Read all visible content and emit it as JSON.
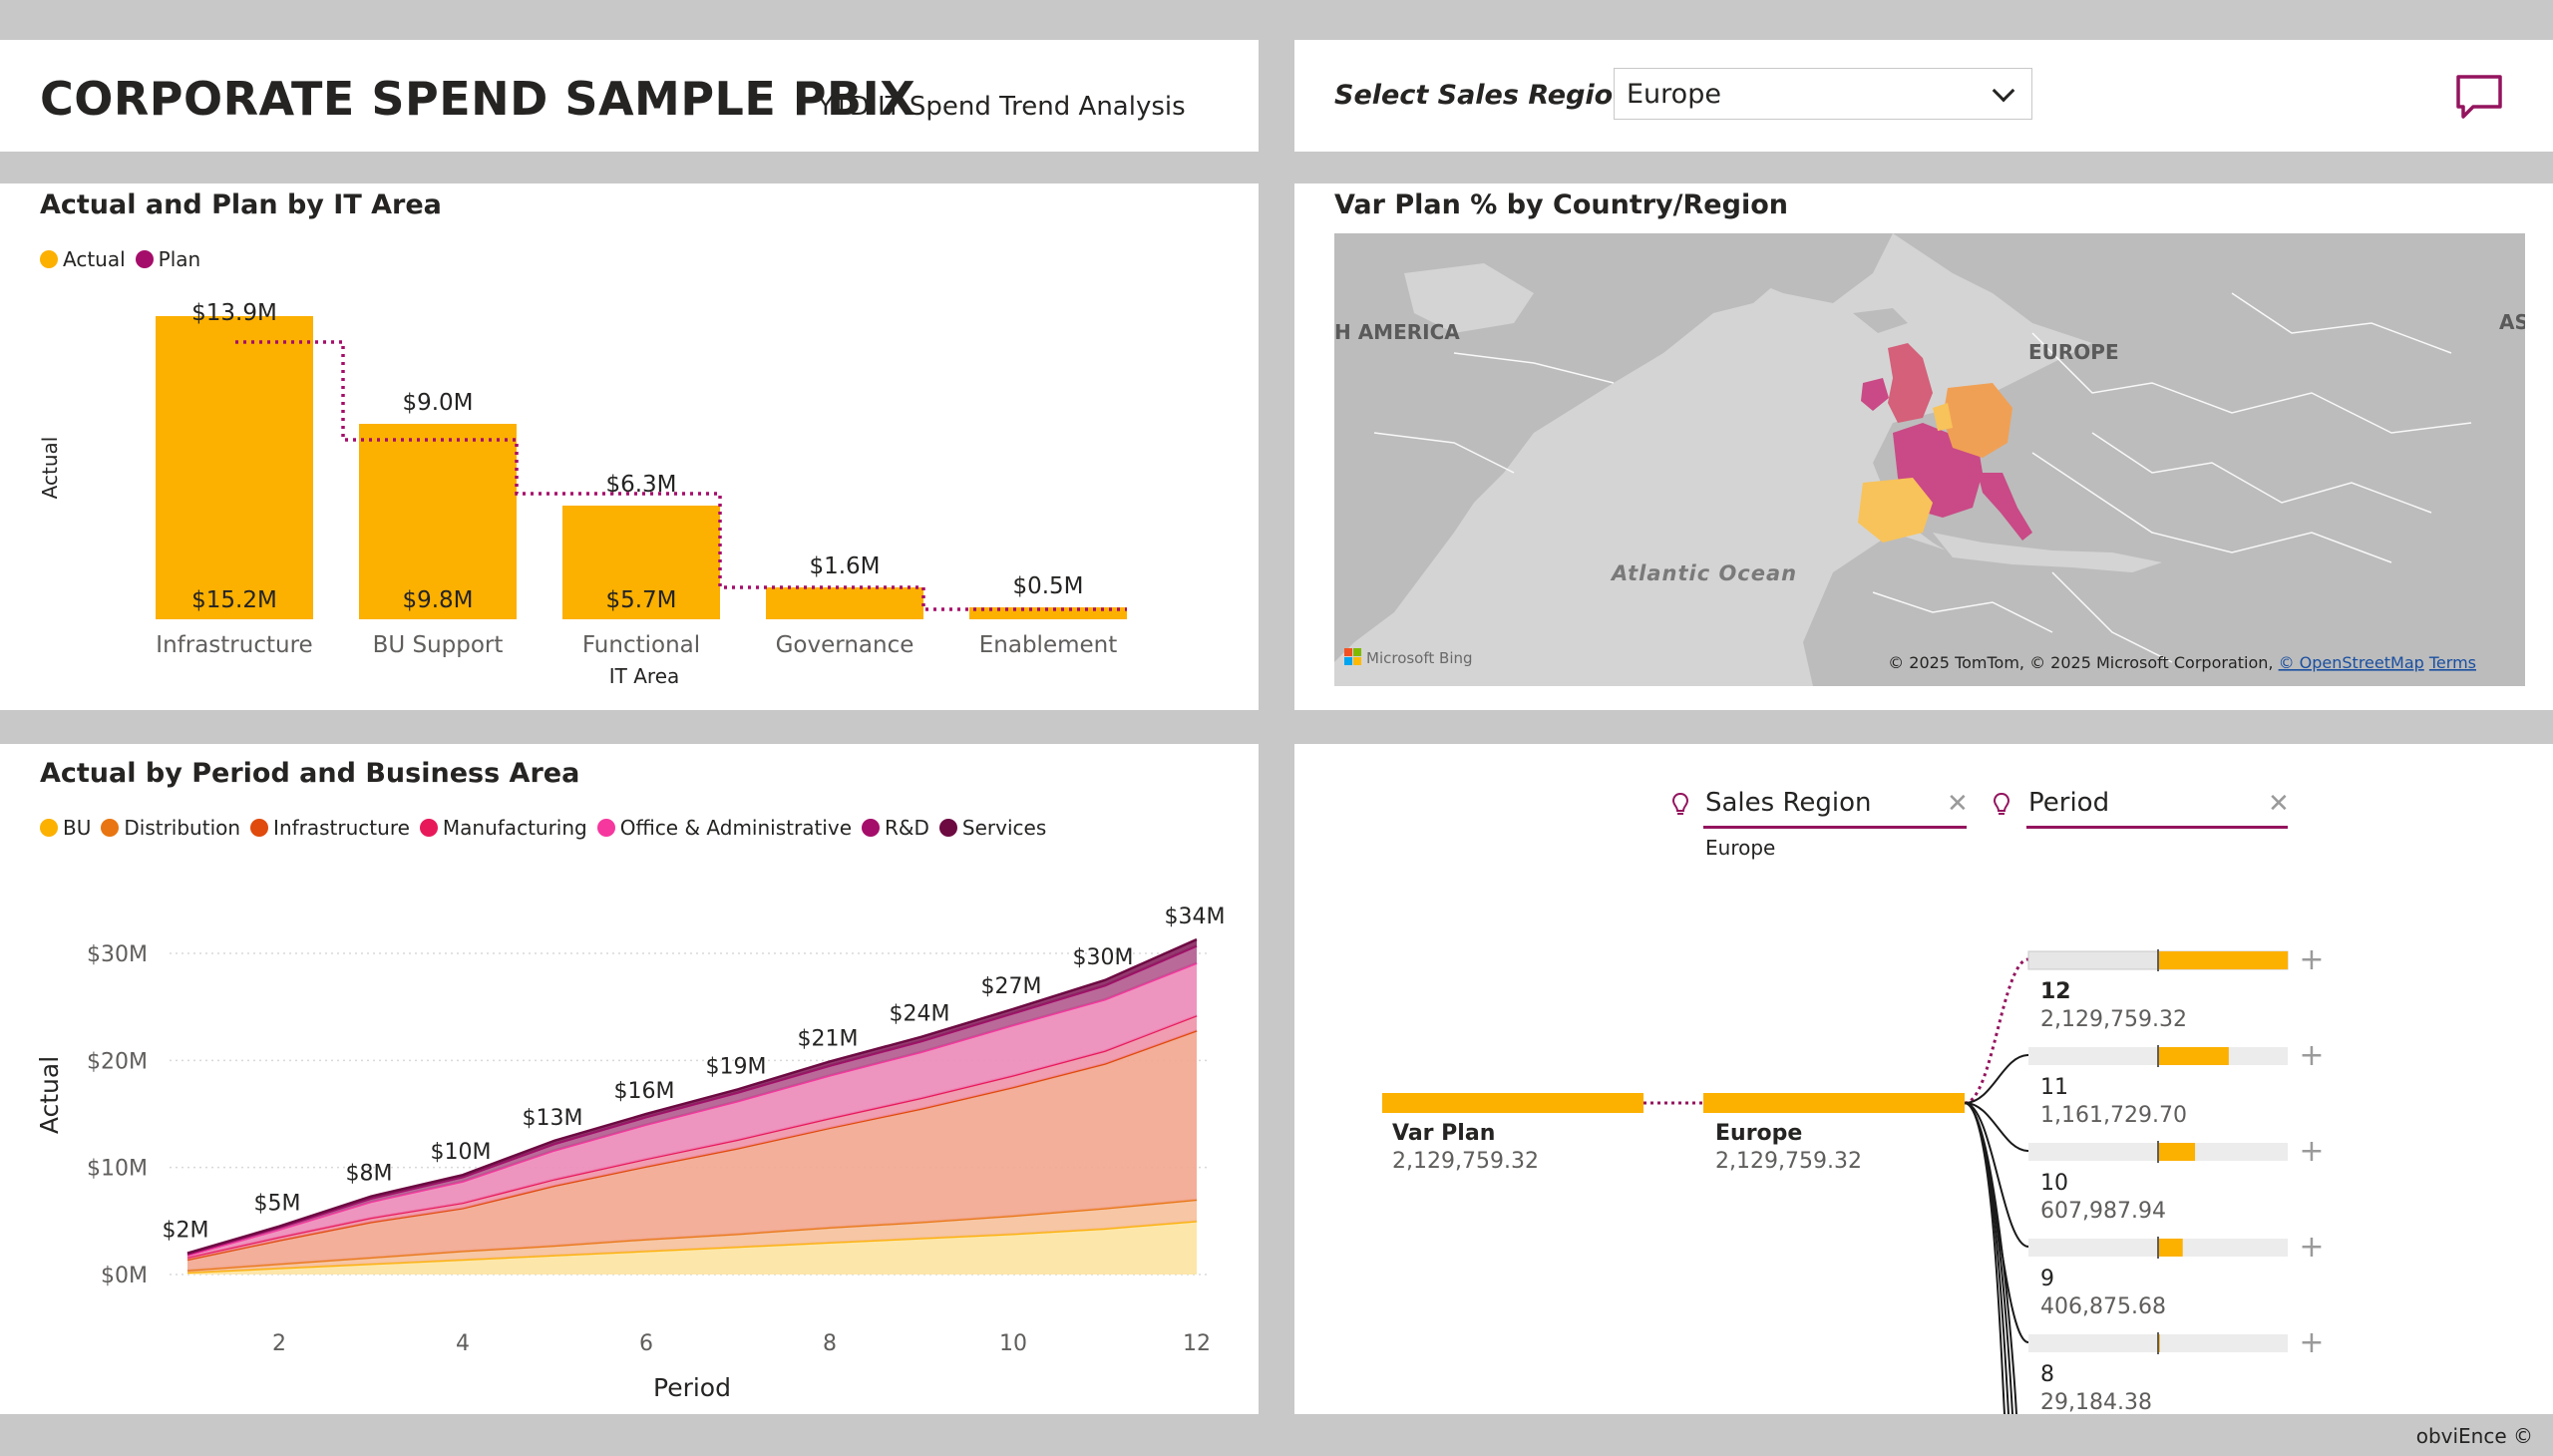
{
  "header": {
    "title": "CORPORATE SPEND SAMPLE PBIX",
    "subtitle": "YTD IT Spend Trend Analysis"
  },
  "filter": {
    "label": "Select Sales Region",
    "selected": "Europe"
  },
  "colors": {
    "actual": "#fcb000",
    "plan": "#a50d6a",
    "accent": "#94145e",
    "map_land": "#b9b9b9",
    "map_water": "#d4d4d4"
  },
  "icons": [
    "comment-icon",
    "chevron-down-icon",
    "lightbulb-icon",
    "close-icon",
    "plus-icon"
  ],
  "bar_chart": {
    "title": "Actual and Plan by IT Area",
    "legend": [
      "Actual",
      "Plan"
    ],
    "ylabel": "Actual",
    "xlabel": "IT Area",
    "xlabel_line1": "Functional",
    "xlabel_line2": "IT Area"
  },
  "map": {
    "title": "Var Plan % by Country/Region",
    "labels": {
      "north_america": "H AMERICA",
      "europe": "EUROPE",
      "asia": "AS",
      "ocean": "Atlantic Ocean"
    },
    "bing": "Microsoft Bing",
    "attribution": "© 2025 TomTom, © 2025 Microsoft Corporation, ",
    "osm": "© OpenStreetMap",
    "terms": "Terms"
  },
  "area_chart": {
    "title": "Actual by Period and Business Area",
    "ylabel": "Actual",
    "xlabel": "Period"
  },
  "decomp": {
    "fields": [
      {
        "label": "Sales Region",
        "value": "Europe"
      },
      {
        "label": "Period",
        "value": ""
      }
    ],
    "root": {
      "label": "Var Plan",
      "value": "2,129,759.32"
    },
    "level1": {
      "label": "Europe",
      "value": "2,129,759.32"
    },
    "nodes": [
      {
        "label": "12",
        "value": "2,129,759.32",
        "fraction": 1.0,
        "selected": true
      },
      {
        "label": "11",
        "value": "1,161,729.70",
        "fraction": 0.545
      },
      {
        "label": "10",
        "value": "607,987.94",
        "fraction": 0.285
      },
      {
        "label": "9",
        "value": "406,875.68",
        "fraction": 0.19
      },
      {
        "label": "8",
        "value": "29,184.38",
        "fraction": 0.014
      }
    ]
  },
  "footer": "obviEnce ©",
  "chart_data": [
    {
      "type": "bar",
      "title": "Actual and Plan by IT Area",
      "xlabel": "IT Area",
      "ylabel": "Actual",
      "categories": [
        "Infrastructure",
        "BU Support",
        "Functional",
        "Governance",
        "Enablement"
      ],
      "series": [
        {
          "name": "Actual",
          "values": [
            15.2,
            9.8,
            5.7,
            1.6,
            0.5
          ],
          "labels": [
            "$15.2M",
            "$9.8M",
            "$5.7M",
            "",
            ""
          ]
        },
        {
          "name": "Plan",
          "values": [
            13.9,
            9.0,
            6.3,
            1.6,
            0.5
          ],
          "labels": [
            "$13.9M",
            "$9.0M",
            "$6.3M",
            "$1.6M",
            "$0.5M"
          ]
        }
      ],
      "legend": "top-left"
    },
    {
      "type": "area",
      "title": "Actual by Period and Business Area",
      "xlabel": "Period",
      "ylabel": "Actual",
      "x": [
        1,
        2,
        3,
        4,
        5,
        6,
        7,
        8,
        9,
        10,
        11,
        12
      ],
      "x_ticks": [
        "2",
        "4",
        "6",
        "8",
        "10",
        "12"
      ],
      "y_ticks": [
        "$0M",
        "$10M",
        "$20M",
        "$30M"
      ],
      "ylim": [
        0,
        34
      ],
      "series": [
        {
          "name": "BU",
          "color": "#fcb000",
          "values": [
            0.2,
            0.6,
            1.0,
            1.4,
            1.8,
            2.2,
            2.6,
            3.0,
            3.4,
            3.8,
            4.3,
            5.0
          ]
        },
        {
          "name": "Distribution",
          "color": "#e87511",
          "values": [
            0.2,
            0.4,
            0.6,
            0.8,
            0.9,
            1.1,
            1.2,
            1.4,
            1.5,
            1.7,
            1.9,
            2.0
          ]
        },
        {
          "name": "Infrastructure",
          "color": "#e04a0c",
          "values": [
            1.0,
            2.2,
            3.3,
            4.0,
            5.6,
            6.8,
            8.0,
            9.3,
            10.6,
            12.0,
            13.5,
            15.8
          ]
        },
        {
          "name": "Manufacturing",
          "color": "#e8195b",
          "values": [
            0.2,
            0.3,
            0.4,
            0.5,
            0.6,
            0.7,
            0.8,
            0.9,
            1.0,
            1.1,
            1.2,
            1.4
          ]
        },
        {
          "name": "Office & Administrative",
          "color": "#f6379e",
          "values": [
            0.2,
            0.7,
            1.5,
            2.0,
            2.7,
            3.2,
            3.6,
            4.0,
            4.3,
            4.7,
            4.8,
            4.9
          ]
        },
        {
          "name": "R&D",
          "color": "#a50d6a",
          "values": [
            0.1,
            0.2,
            0.3,
            0.4,
            0.6,
            0.7,
            0.8,
            0.9,
            1.0,
            1.1,
            1.3,
            1.6
          ]
        },
        {
          "name": "Services",
          "color": "#6d0a42",
          "values": [
            0.1,
            0.1,
            0.2,
            0.2,
            0.3,
            0.3,
            0.3,
            0.4,
            0.4,
            0.4,
            0.5,
            0.6
          ]
        }
      ],
      "total_labels": [
        "$2M",
        "$5M",
        "$8M",
        "$10M",
        "$13M",
        "$16M",
        "$19M",
        "$21M",
        "$24M",
        "$27M",
        "$30M",
        "$34M"
      ],
      "legend": "top-left"
    }
  ]
}
